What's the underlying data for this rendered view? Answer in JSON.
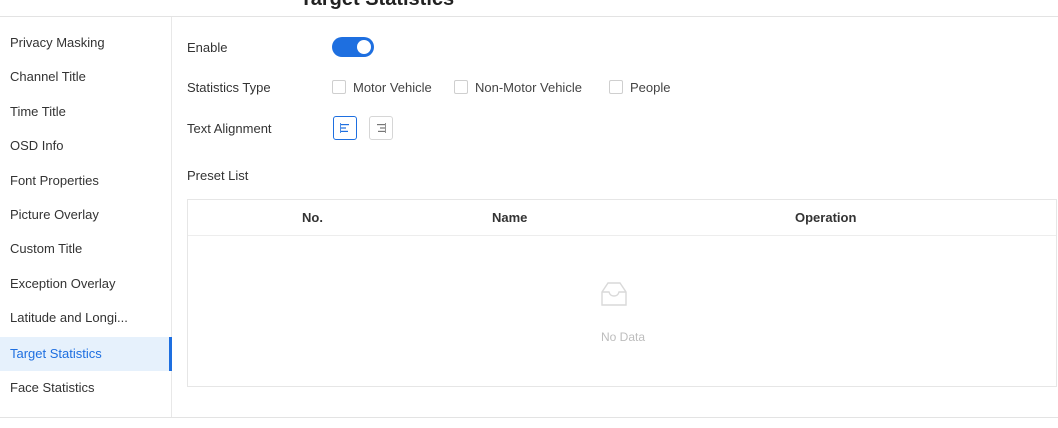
{
  "header": {
    "title": "Target Statistics"
  },
  "sidebar": {
    "items": [
      {
        "label": "Privacy Masking"
      },
      {
        "label": "Channel Title"
      },
      {
        "label": "Time Title"
      },
      {
        "label": "OSD Info"
      },
      {
        "label": "Font Properties"
      },
      {
        "label": "Picture Overlay"
      },
      {
        "label": "Custom Title"
      },
      {
        "label": "Exception Overlay"
      },
      {
        "label": "Latitude and Longi..."
      },
      {
        "label": "Target Statistics",
        "active": true
      },
      {
        "label": "Face Statistics"
      }
    ]
  },
  "form": {
    "enable_label": "Enable",
    "enable_value": true,
    "stats_type_label": "Statistics Type",
    "stats_types": [
      {
        "label": "Motor Vehicle",
        "checked": false
      },
      {
        "label": "Non-Motor Vehicle",
        "checked": false
      },
      {
        "label": "People",
        "checked": false
      }
    ],
    "text_alignment_label": "Text Alignment",
    "alignment_selected": "left",
    "preset_list_label": "Preset List"
  },
  "table": {
    "columns": [
      "No.",
      "Name",
      "Operation"
    ],
    "rows": [],
    "empty_text": "No Data"
  },
  "colors": {
    "accent": "#1e6fe0",
    "active_bg": "#e6f1fc",
    "border": "#e6e6e6"
  },
  "icons": {
    "align_left": "align-left-icon",
    "align_right": "align-right-icon",
    "empty": "empty-tray-icon"
  }
}
